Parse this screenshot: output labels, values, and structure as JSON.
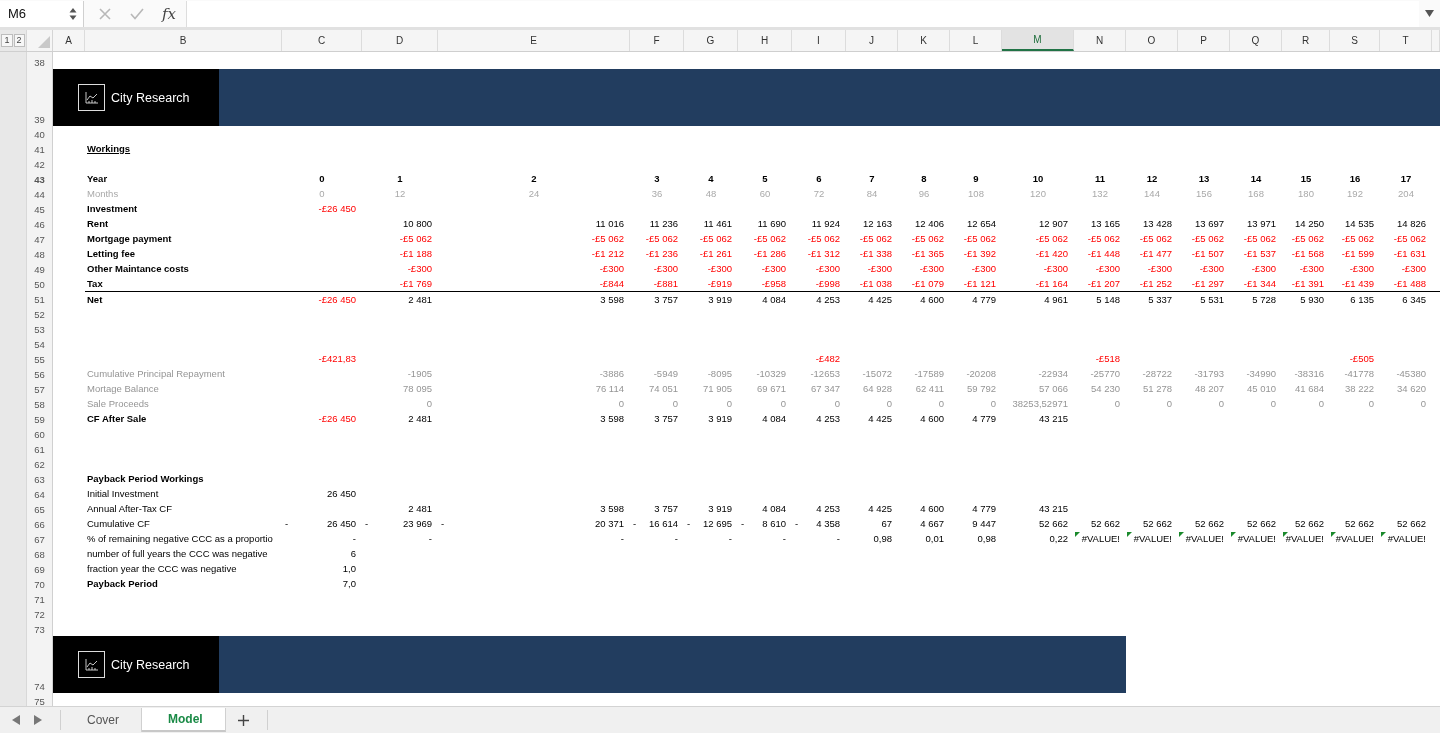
{
  "formula_bar": {
    "name_box": "M6",
    "function_label": "fx"
  },
  "outline_levels": [
    "1",
    "2"
  ],
  "columns": [
    {
      "label": "A",
      "selected": false
    },
    {
      "label": "B",
      "selected": false
    },
    {
      "label": "C",
      "selected": false
    },
    {
      "label": "D",
      "selected": false
    },
    {
      "label": "E",
      "selected": false
    },
    {
      "label": "F",
      "selected": false
    },
    {
      "label": "G",
      "selected": false
    },
    {
      "label": "H",
      "selected": false
    },
    {
      "label": "I",
      "selected": false
    },
    {
      "label": "J",
      "selected": false
    },
    {
      "label": "K",
      "selected": false
    },
    {
      "label": "L",
      "selected": false
    },
    {
      "label": "M",
      "selected": true
    },
    {
      "label": "N",
      "selected": false
    },
    {
      "label": "O",
      "selected": false
    },
    {
      "label": "P",
      "selected": false
    },
    {
      "label": "Q",
      "selected": false
    },
    {
      "label": "R",
      "selected": false
    },
    {
      "label": "S",
      "selected": false
    },
    {
      "label": "T",
      "selected": false
    }
  ],
  "rows": [
    {
      "num": "38",
      "kind": "blank"
    },
    {
      "num": "39",
      "kind": "banner",
      "brand": "City Research"
    },
    {
      "num": "40",
      "kind": "blank"
    },
    {
      "num": "41",
      "kind": "title",
      "label": "Workings"
    },
    {
      "num": "42",
      "kind": "blank"
    },
    {
      "num": "43",
      "kind": "axis",
      "label": "Year",
      "cells": {
        "C": {
          "text": "0",
          "negative": false
        },
        "D": {
          "text": "1",
          "negative": false
        },
        "E": {
          "text": "2",
          "negative": false
        },
        "F": {
          "text": "3",
          "negative": false
        },
        "G": {
          "text": "4",
          "negative": false
        },
        "H": {
          "text": "5",
          "negative": false
        },
        "I": {
          "text": "6",
          "negative": false
        },
        "J": {
          "text": "7",
          "negative": false
        },
        "K": {
          "text": "8",
          "negative": false
        },
        "L": {
          "text": "9",
          "negative": false
        },
        "M": {
          "text": "10",
          "negative": false
        },
        "N": {
          "text": "11",
          "negative": false
        },
        "O": {
          "text": "12",
          "negative": false
        },
        "P": {
          "text": "13",
          "negative": false
        },
        "Q": {
          "text": "14",
          "negative": false
        },
        "R": {
          "text": "15",
          "negative": false
        },
        "S": {
          "text": "16",
          "negative": false
        },
        "T": {
          "text": "17",
          "negative": false
        }
      }
    },
    {
      "num": "44",
      "kind": "faint_axis",
      "label": "Months",
      "cells": {
        "C": {
          "text": "0",
          "negative": false
        },
        "D": {
          "text": "12",
          "negative": false
        },
        "E": {
          "text": "24",
          "negative": false
        },
        "F": {
          "text": "36",
          "negative": false
        },
        "G": {
          "text": "48",
          "negative": false
        },
        "H": {
          "text": "60",
          "negative": false
        },
        "I": {
          "text": "72",
          "negative": false
        },
        "J": {
          "text": "84",
          "negative": false
        },
        "K": {
          "text": "96",
          "negative": false
        },
        "L": {
          "text": "108",
          "negative": false
        },
        "M": {
          "text": "120",
          "negative": false
        },
        "N": {
          "text": "132",
          "negative": false
        },
        "O": {
          "text": "144",
          "negative": false
        },
        "P": {
          "text": "156",
          "negative": false
        },
        "Q": {
          "text": "168",
          "negative": false
        },
        "R": {
          "text": "180",
          "negative": false
        },
        "S": {
          "text": "192",
          "negative": false
        },
        "T": {
          "text": "204",
          "negative": false
        }
      }
    },
    {
      "num": "45",
      "kind": "bold",
      "label": "Investment",
      "cells": {
        "C": {
          "text": "-£26 450",
          "negative": true
        }
      }
    },
    {
      "num": "46",
      "kind": "bold",
      "label": "Rent",
      "cells": {
        "D": {
          "text": "10 800",
          "negative": false
        },
        "E": {
          "text": "11 016",
          "negative": false
        },
        "F": {
          "text": "11 236",
          "negative": false
        },
        "G": {
          "text": "11 461",
          "negative": false
        },
        "H": {
          "text": "11 690",
          "negative": false
        },
        "I": {
          "text": "11 924",
          "negative": false
        },
        "J": {
          "text": "12 163",
          "negative": false
        },
        "K": {
          "text": "12 406",
          "negative": false
        },
        "L": {
          "text": "12 654",
          "negative": false
        },
        "M": {
          "text": "12 907",
          "negative": false
        },
        "N": {
          "text": "13 165",
          "negative": false
        },
        "O": {
          "text": "13 428",
          "negative": false
        },
        "P": {
          "text": "13 697",
          "negative": false
        },
        "Q": {
          "text": "13 971",
          "negative": false
        },
        "R": {
          "text": "14 250",
          "negative": false
        },
        "S": {
          "text": "14 535",
          "negative": false
        },
        "T": {
          "text": "14 826",
          "negative": false
        }
      }
    },
    {
      "num": "47",
      "kind": "bold",
      "label": "Mortgage payment",
      "cells": {
        "D": {
          "text": "-£5 062",
          "negative": true
        },
        "E": {
          "text": "-£5 062",
          "negative": true
        },
        "F": {
          "text": "-£5 062",
          "negative": true
        },
        "G": {
          "text": "-£5 062",
          "negative": true
        },
        "H": {
          "text": "-£5 062",
          "negative": true
        },
        "I": {
          "text": "-£5 062",
          "negative": true
        },
        "J": {
          "text": "-£5 062",
          "negative": true
        },
        "K": {
          "text": "-£5 062",
          "negative": true
        },
        "L": {
          "text": "-£5 062",
          "negative": true
        },
        "M": {
          "text": "-£5 062",
          "negative": true
        },
        "N": {
          "text": "-£5 062",
          "negative": true
        },
        "O": {
          "text": "-£5 062",
          "negative": true
        },
        "P": {
          "text": "-£5 062",
          "negative": true
        },
        "Q": {
          "text": "-£5 062",
          "negative": true
        },
        "R": {
          "text": "-£5 062",
          "negative": true
        },
        "S": {
          "text": "-£5 062",
          "negative": true
        },
        "T": {
          "text": "-£5 062",
          "negative": true
        }
      }
    },
    {
      "num": "48",
      "kind": "bold",
      "label": "Letting fee",
      "cells": {
        "D": {
          "text": "-£1 188",
          "negative": true
        },
        "E": {
          "text": "-£1 212",
          "negative": true
        },
        "F": {
          "text": "-£1 236",
          "negative": true
        },
        "G": {
          "text": "-£1 261",
          "negative": true
        },
        "H": {
          "text": "-£1 286",
          "negative": true
        },
        "I": {
          "text": "-£1 312",
          "negative": true
        },
        "J": {
          "text": "-£1 338",
          "negative": true
        },
        "K": {
          "text": "-£1 365",
          "negative": true
        },
        "L": {
          "text": "-£1 392",
          "negative": true
        },
        "M": {
          "text": "-£1 420",
          "negative": true
        },
        "N": {
          "text": "-£1 448",
          "negative": true
        },
        "O": {
          "text": "-£1 477",
          "negative": true
        },
        "P": {
          "text": "-£1 507",
          "negative": true
        },
        "Q": {
          "text": "-£1 537",
          "negative": true
        },
        "R": {
          "text": "-£1 568",
          "negative": true
        },
        "S": {
          "text": "-£1 599",
          "negative": true
        },
        "T": {
          "text": "-£1 631",
          "negative": true
        }
      }
    },
    {
      "num": "49",
      "kind": "bold",
      "label": "Other Maintance costs",
      "cells": {
        "D": {
          "text": "-£300",
          "negative": true
        },
        "E": {
          "text": "-£300",
          "negative": true
        },
        "F": {
          "text": "-£300",
          "negative": true
        },
        "G": {
          "text": "-£300",
          "negative": true
        },
        "H": {
          "text": "-£300",
          "negative": true
        },
        "I": {
          "text": "-£300",
          "negative": true
        },
        "J": {
          "text": "-£300",
          "negative": true
        },
        "K": {
          "text": "-£300",
          "negative": true
        },
        "L": {
          "text": "-£300",
          "negative": true
        },
        "M": {
          "text": "-£300",
          "negative": true
        },
        "N": {
          "text": "-£300",
          "negative": true
        },
        "O": {
          "text": "-£300",
          "negative": true
        },
        "P": {
          "text": "-£300",
          "negative": true
        },
        "Q": {
          "text": "-£300",
          "negative": true
        },
        "R": {
          "text": "-£300",
          "negative": true
        },
        "S": {
          "text": "-£300",
          "negative": true
        },
        "T": {
          "text": "-£300",
          "negative": true
        }
      }
    },
    {
      "num": "50",
      "kind": "bold",
      "label": "Tax",
      "cells": {
        "D": {
          "text": "-£1 769",
          "negative": true
        },
        "E": {
          "text": "-£844",
          "negative": true
        },
        "F": {
          "text": "-£881",
          "negative": true
        },
        "G": {
          "text": "-£919",
          "negative": true
        },
        "H": {
          "text": "-£958",
          "negative": true
        },
        "I": {
          "text": "-£998",
          "negative": true
        },
        "J": {
          "text": "-£1 038",
          "negative": true
        },
        "K": {
          "text": "-£1 079",
          "negative": true
        },
        "L": {
          "text": "-£1 121",
          "negative": true
        },
        "M": {
          "text": "-£1 164",
          "negative": true
        },
        "N": {
          "text": "-£1 207",
          "negative": true
        },
        "O": {
          "text": "-£1 252",
          "negative": true
        },
        "P": {
          "text": "-£1 297",
          "negative": true
        },
        "Q": {
          "text": "-£1 344",
          "negative": true
        },
        "R": {
          "text": "-£1 391",
          "negative": true
        },
        "S": {
          "text": "-£1 439",
          "negative": true
        },
        "T": {
          "text": "-£1 488",
          "negative": true
        }
      }
    },
    {
      "num": "51",
      "kind": "total",
      "label": "Net",
      "cells": {
        "C": {
          "text": "-£26 450",
          "negative": true
        },
        "D": {
          "text": "2 481",
          "negative": false
        },
        "E": {
          "text": "3 598",
          "negative": false
        },
        "F": {
          "text": "3 757",
          "negative": false
        },
        "G": {
          "text": "3 919",
          "negative": false
        },
        "H": {
          "text": "4 084",
          "negative": false
        },
        "I": {
          "text": "4 253",
          "negative": false
        },
        "J": {
          "text": "4 425",
          "negative": false
        },
        "K": {
          "text": "4 600",
          "negative": false
        },
        "L": {
          "text": "4 779",
          "negative": false
        },
        "M": {
          "text": "4 961",
          "negative": false
        },
        "N": {
          "text": "5 148",
          "negative": false
        },
        "O": {
          "text": "5 337",
          "negative": false
        },
        "P": {
          "text": "5 531",
          "negative": false
        },
        "Q": {
          "text": "5 728",
          "negative": false
        },
        "R": {
          "text": "5 930",
          "negative": false
        },
        "S": {
          "text": "6 135",
          "negative": false
        },
        "T": {
          "text": "6 345",
          "negative": false
        }
      }
    },
    {
      "num": "52",
      "kind": "blank"
    },
    {
      "num": "53",
      "kind": "blank"
    },
    {
      "num": "54",
      "kind": "blank"
    },
    {
      "num": "55",
      "kind": "plain",
      "cells": {
        "C": {
          "text": "-£421,83",
          "negative": true
        },
        "I": {
          "text": "-£482",
          "negative": true
        },
        "N": {
          "text": "-£518",
          "negative": true
        },
        "S": {
          "text": "-£505",
          "negative": true
        }
      }
    },
    {
      "num": "56",
      "kind": "muted",
      "label": "Cumulative Principal Repayment",
      "cells": {
        "D": {
          "text": "-1905",
          "negative": false
        },
        "E": {
          "text": "-3886",
          "negative": false
        },
        "F": {
          "text": "-5949",
          "negative": false
        },
        "G": {
          "text": "-8095",
          "negative": false
        },
        "H": {
          "text": "-10329",
          "negative": false
        },
        "I": {
          "text": "-12653",
          "negative": false
        },
        "J": {
          "text": "-15072",
          "negative": false
        },
        "K": {
          "text": "-17589",
          "negative": false
        },
        "L": {
          "text": "-20208",
          "negative": false
        },
        "M": {
          "text": "-22934",
          "negative": false
        },
        "N": {
          "text": "-25770",
          "negative": false
        },
        "O": {
          "text": "-28722",
          "negative": false
        },
        "P": {
          "text": "-31793",
          "negative": false
        },
        "Q": {
          "text": "-34990",
          "negative": false
        },
        "R": {
          "text": "-38316",
          "negative": false
        },
        "S": {
          "text": "-41778",
          "negative": false
        },
        "T": {
          "text": "-45380",
          "negative": false
        }
      }
    },
    {
      "num": "57",
      "kind": "muted",
      "label": "Mortage Balance",
      "cells": {
        "D": {
          "text": "78 095",
          "negative": false
        },
        "E": {
          "text": "76 114",
          "negative": false
        },
        "F": {
          "text": "74 051",
          "negative": false
        },
        "G": {
          "text": "71 905",
          "negative": false
        },
        "H": {
          "text": "69 671",
          "negative": false
        },
        "I": {
          "text": "67 347",
          "negative": false
        },
        "J": {
          "text": "64 928",
          "negative": false
        },
        "K": {
          "text": "62 411",
          "negative": false
        },
        "L": {
          "text": "59 792",
          "negative": false
        },
        "M": {
          "text": "57 066",
          "negative": false
        },
        "N": {
          "text": "54 230",
          "negative": false
        },
        "O": {
          "text": "51 278",
          "negative": false
        },
        "P": {
          "text": "48 207",
          "negative": false
        },
        "Q": {
          "text": "45 010",
          "negative": false
        },
        "R": {
          "text": "41 684",
          "negative": false
        },
        "S": {
          "text": "38 222",
          "negative": false
        },
        "T": {
          "text": "34 620",
          "negative": false
        }
      }
    },
    {
      "num": "58",
      "kind": "muted",
      "label": "Sale Proceeds",
      "cells": {
        "D": {
          "text": "0",
          "negative": false
        },
        "E": {
          "text": "0",
          "negative": false
        },
        "F": {
          "text": "0",
          "negative": false
        },
        "G": {
          "text": "0",
          "negative": false
        },
        "H": {
          "text": "0",
          "negative": false
        },
        "I": {
          "text": "0",
          "negative": false
        },
        "J": {
          "text": "0",
          "negative": false
        },
        "K": {
          "text": "0",
          "negative": false
        },
        "L": {
          "text": "0",
          "negative": false
        },
        "M": {
          "text": "38253,52971",
          "negative": false
        },
        "N": {
          "text": "0",
          "negative": false
        },
        "O": {
          "text": "0",
          "negative": false
        },
        "P": {
          "text": "0",
          "negative": false
        },
        "Q": {
          "text": "0",
          "negative": false
        },
        "R": {
          "text": "0",
          "negative": false
        },
        "S": {
          "text": "0",
          "negative": false
        },
        "T": {
          "text": "0",
          "negative": false
        }
      }
    },
    {
      "num": "59",
      "kind": "bold",
      "label": "CF After Sale",
      "cells": {
        "C": {
          "text": "-£26 450",
          "negative": true
        },
        "D": {
          "text": "2 481",
          "negative": false
        },
        "E": {
          "text": "3 598",
          "negative": false
        },
        "F": {
          "text": "3 757",
          "negative": false
        },
        "G": {
          "text": "3 919",
          "negative": false
        },
        "H": {
          "text": "4 084",
          "negative": false
        },
        "I": {
          "text": "4 253",
          "negative": false
        },
        "J": {
          "text": "4 425",
          "negative": false
        },
        "K": {
          "text": "4 600",
          "negative": false
        },
        "L": {
          "text": "4 779",
          "negative": false
        },
        "M": {
          "text": "43 215",
          "negative": false
        }
      }
    },
    {
      "num": "60",
      "kind": "blank"
    },
    {
      "num": "61",
      "kind": "blank"
    },
    {
      "num": "62",
      "kind": "blank"
    },
    {
      "num": "63",
      "kind": "bold",
      "label": "Payback Period Workings"
    },
    {
      "num": "64",
      "kind": "plain",
      "label": "Initial Investment",
      "cells": {
        "C": {
          "text": "26 450",
          "negative": false
        }
      }
    },
    {
      "num": "65",
      "kind": "plain",
      "label": "Annual After-Tax CF",
      "cells": {
        "D": {
          "text": "2 481",
          "negative": false
        },
        "E": {
          "text": "3 598",
          "negative": false
        },
        "F": {
          "text": "3 757",
          "negative": false
        },
        "G": {
          "text": "3 919",
          "negative": false
        },
        "H": {
          "text": "4 084",
          "negative": false
        },
        "I": {
          "text": "4 253",
          "negative": false
        },
        "J": {
          "text": "4 425",
          "negative": false
        },
        "K": {
          "text": "4 600",
          "negative": false
        },
        "L": {
          "text": "4 779",
          "negative": false
        },
        "M": {
          "text": "43 215",
          "negative": false
        }
      }
    },
    {
      "num": "66",
      "kind": "plain",
      "label": "Cumulative CF",
      "cells": {
        "C": {
          "sign": "-",
          "text": "26 450",
          "negative": false
        },
        "D": {
          "sign": "-",
          "text": "23 969",
          "negative": false
        },
        "E": {
          "sign": "-",
          "text": "20 371",
          "negative": false
        },
        "F": {
          "sign": "-",
          "text": "16 614",
          "negative": false
        },
        "G": {
          "sign": "-",
          "text": "12 695",
          "negative": false
        },
        "H": {
          "sign": "-",
          "text": "8 610",
          "negative": false
        },
        "I": {
          "sign": "-",
          "text": "4 358",
          "negative": false
        },
        "J": {
          "text": "67",
          "negative": false
        },
        "K": {
          "text": "4 667",
          "negative": false
        },
        "L": {
          "text": "9 447",
          "negative": false
        },
        "M": {
          "text": "52 662",
          "negative": false
        },
        "N": {
          "text": "52 662",
          "negative": false
        },
        "O": {
          "text": "52 662",
          "negative": false
        },
        "P": {
          "text": "52 662",
          "negative": false
        },
        "Q": {
          "text": "52 662",
          "negative": false
        },
        "R": {
          "text": "52 662",
          "negative": false
        },
        "S": {
          "text": "52 662",
          "negative": false
        },
        "T": {
          "text": "52 662",
          "negative": false
        }
      }
    },
    {
      "num": "67",
      "kind": "plain",
      "label": "% of remaining negative CCC as a proportio",
      "cells": {
        "C": {
          "text": "-",
          "negative": false,
          "error": false
        },
        "D": {
          "text": "-",
          "negative": false,
          "error": false
        },
        "E": {
          "text": "-",
          "negative": false,
          "error": false
        },
        "F": {
          "text": "-",
          "negative": false,
          "error": false
        },
        "G": {
          "text": "-",
          "negative": false,
          "error": false
        },
        "H": {
          "text": "-",
          "negative": false,
          "error": false
        },
        "I": {
          "text": "-",
          "negative": false,
          "error": false
        },
        "J": {
          "text": "0,98",
          "negative": false,
          "error": false
        },
        "K": {
          "text": "0,01",
          "negative": false,
          "error": false
        },
        "L": {
          "text": "0,98",
          "negative": false,
          "error": false
        },
        "M": {
          "text": "0,22",
          "negative": false,
          "error": false
        },
        "N": {
          "text": "#VALUE!",
          "negative": false,
          "error": true
        },
        "O": {
          "text": "#VALUE!",
          "negative": false,
          "error": true
        },
        "P": {
          "text": "#VALUE!",
          "negative": false,
          "error": true
        },
        "Q": {
          "text": "#VALUE!",
          "negative": false,
          "error": true
        },
        "R": {
          "text": "#VALUE!",
          "negative": false,
          "error": true
        },
        "S": {
          "text": "#VALUE!",
          "negative": false,
          "error": true
        },
        "T": {
          "text": "#VALUE!",
          "negative": false,
          "error": true
        }
      }
    },
    {
      "num": "68",
      "kind": "plain",
      "label": "number of full years the CCC was negative",
      "cells": {
        "C": {
          "text": "6",
          "negative": false
        }
      }
    },
    {
      "num": "69",
      "kind": "plain",
      "label": "fraction year the CCC was negative",
      "cells": {
        "C": {
          "text": "1,0",
          "negative": false
        }
      }
    },
    {
      "num": "70",
      "kind": "bold",
      "label": "Payback Period",
      "cells": {
        "C": {
          "text": "7,0",
          "negative": false
        }
      }
    },
    {
      "num": "71",
      "kind": "blank"
    },
    {
      "num": "72",
      "kind": "blank"
    },
    {
      "num": "73",
      "kind": "blank"
    },
    {
      "num": "74",
      "kind": "short_banner",
      "brand": "City Research"
    },
    {
      "num": "75",
      "kind": "blank"
    }
  ],
  "sheet_tabs": [
    {
      "label": "Cover",
      "selected": false
    },
    {
      "label": "Model",
      "selected": true
    }
  ]
}
